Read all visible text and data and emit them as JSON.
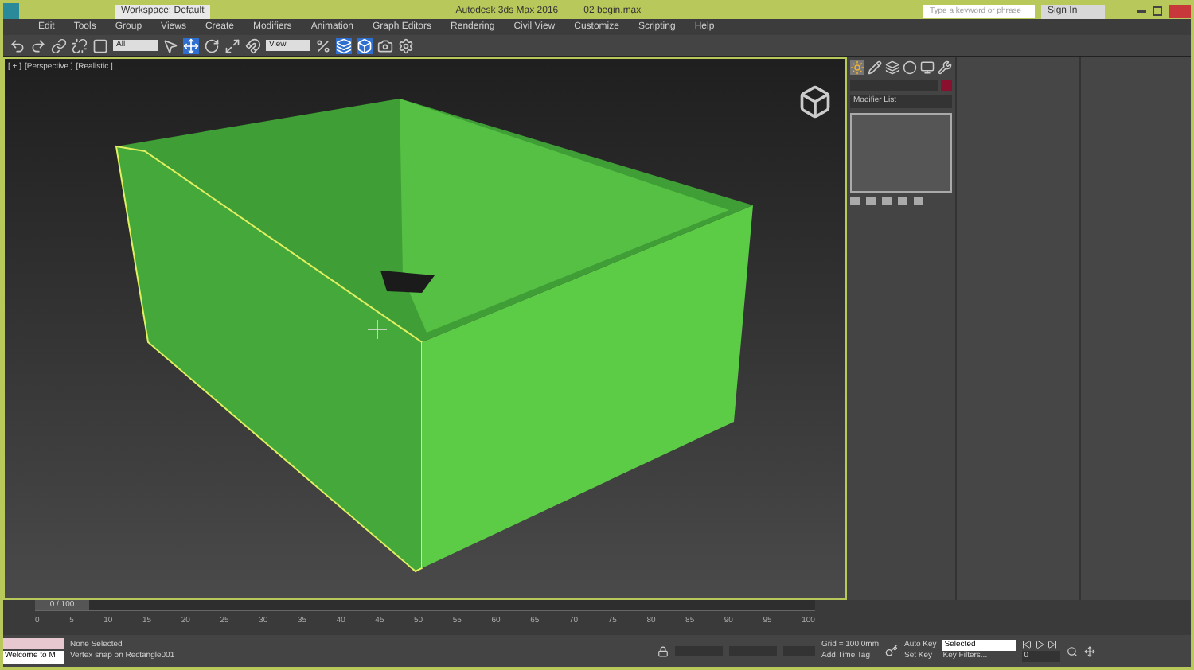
{
  "title_bar": {
    "workspace": "Workspace: Default",
    "title": "Autodesk 3ds Max 2016",
    "file": "02 begin.max",
    "search": {
      "placeholder": "Type a keyword or phrase"
    },
    "sign_in": "Sign In"
  },
  "menu": [
    "Edit",
    "Tools",
    "Group",
    "Views",
    "Create",
    "Modifiers",
    "Animation",
    "Graph Editors",
    "Rendering",
    "Civil View",
    "Customize",
    "Scripting",
    "Help"
  ],
  "toolbar": {
    "selection_filter": "All",
    "reference_coord": "View",
    "buttons": [
      {
        "active": false
      },
      {
        "active": false
      },
      {
        "active": false
      },
      {
        "active": false
      },
      {
        "active": false
      },
      {
        "active": false
      },
      {
        "active": true
      },
      {
        "active": false
      },
      {
        "active": false
      },
      {
        "active": false
      },
      {
        "active": false
      },
      {
        "active": true
      },
      {
        "active": true
      },
      {
        "active": false
      },
      {
        "active": false
      }
    ]
  },
  "viewport": {
    "labels": [
      "[ + ]",
      "[Perspective ]",
      "[Realistic ]"
    ]
  },
  "command_panel": {
    "tabs": [
      {
        "selected": true
      },
      {
        "selected": false
      },
      {
        "selected": false
      },
      {
        "selected": false
      },
      {
        "selected": false
      },
      {
        "selected": false
      }
    ],
    "modifier_list": "Modifier List"
  },
  "timeline": {
    "frame": "0 / 100",
    "level": 0,
    "ticks": [
      "0",
      "5",
      "10",
      "15",
      "20",
      "25",
      "30",
      "35",
      "40",
      "45",
      "50",
      "55",
      "60",
      "65",
      "70",
      "75",
      "80",
      "85",
      "90",
      "95",
      "100"
    ]
  },
  "status": {
    "listener": "Welcome to M",
    "selection": "None Selected",
    "prompt": "Vertex snap on Rectangle001",
    "grid": "Grid = 100,0mm",
    "add_time_tag": "Add Time Tag",
    "auto_key": "Auto Key",
    "key_mode": "Selected",
    "set_key": "Set Key",
    "key_filters": "Key Filters...",
    "frame": "0"
  }
}
